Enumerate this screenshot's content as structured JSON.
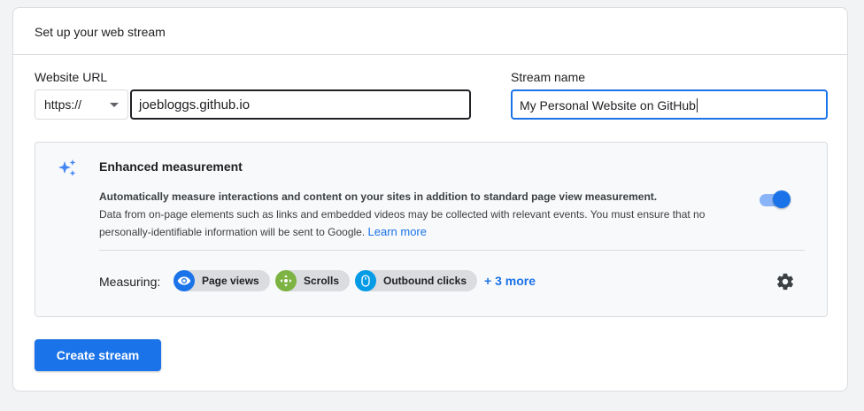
{
  "header": {
    "title": "Set up your web stream"
  },
  "website_url": {
    "label": "Website URL",
    "protocol": "https://",
    "value": "joebloggs.github.io"
  },
  "stream_name": {
    "label": "Stream name",
    "value": "My Personal Website on GitHub"
  },
  "enhanced": {
    "title": "Enhanced measurement",
    "desc_bold": "Automatically measure interactions and content on your sites in addition to standard page view measurement.",
    "desc_rest": "Data from on-page elements such as links and embedded videos may be collected with relevant events. You must ensure that no personally-identifiable information will be sent to Google.",
    "learn_more": "Learn more",
    "enabled": true,
    "measuring_label": "Measuring:",
    "chips": [
      {
        "label": "Page views",
        "icon": "eye-icon",
        "color": "#1a73e8"
      },
      {
        "label": "Scrolls",
        "icon": "crosshair-arrows-icon",
        "color": "#7cb342"
      },
      {
        "label": "Outbound clicks",
        "icon": "mouse-icon",
        "color": "#039be5"
      }
    ],
    "more": "+ 3 more"
  },
  "actions": {
    "create_label": "Create stream"
  },
  "colors": {
    "accent": "#1a73e8",
    "border": "#dadce0",
    "panel": "#f8f9fa"
  }
}
